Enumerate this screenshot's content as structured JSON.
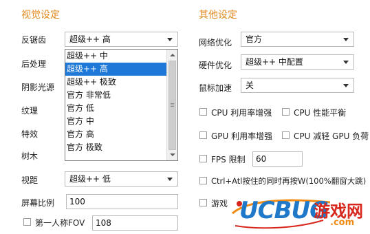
{
  "visual": {
    "title": "视觉设定",
    "labels": {
      "antialias": "反锯齿",
      "postprocess": "后处理",
      "shadow_light": "阴影光源",
      "texture": "纹理",
      "effects": "特效",
      "trees": "树木",
      "view_distance": "视距",
      "screen_ratio": "屏幕比例",
      "first_person_fov": "第一人称FOV"
    },
    "antialias_value": "超级++ 高",
    "dropdown_options": [
      "超级++ 中",
      "超级++ 高",
      "超级++ 极致",
      "官方 非常低",
      "官方 低",
      "官方 中",
      "官方 高",
      "官方 极致"
    ],
    "dropdown_selected_index": 1,
    "view_distance_value": "超级++ 低",
    "screen_ratio_value": "100",
    "fov_value": "108",
    "fov_checked": false
  },
  "other": {
    "title": "其他设定",
    "labels": {
      "network": "网络优化",
      "hardware": "硬件优化",
      "mouse_accel": "鼠标加速"
    },
    "network_value": "官方",
    "hardware_value": "超级++ 中配置",
    "mouse_accel_value": "关",
    "checkboxes": {
      "cpu_enhance": "CPU 利用率增强",
      "cpu_balance": "CPU 性能平衡",
      "gpu_enhance": "GPU 利用率增强",
      "cpu_reduce_gpu": "CPU 减轻 GPU 负荷",
      "fps_limit": "FPS 限制",
      "ctrl_alt": "Ctrl+Atl按住的同时再按W(100%翻窗大跳)",
      "game_partial": "游戏"
    },
    "fps_limit_value": "60"
  },
  "watermark": {
    "brand": "UCBUG",
    "site": "游戏网",
    "domain": ".com"
  },
  "colors": {
    "section_title": "#e08a1e",
    "selection": "#1e78d7",
    "logo_blue": "#1f78c8",
    "logo_orange": "#f08a12",
    "logo_red": "#d8261c"
  }
}
